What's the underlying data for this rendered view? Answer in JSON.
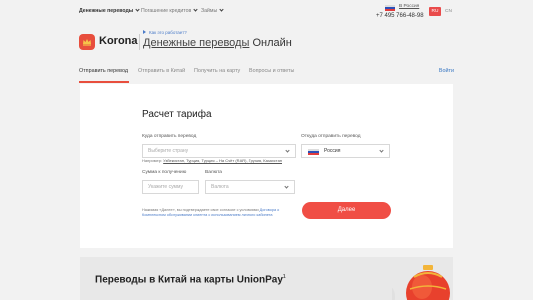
{
  "top_nav": {
    "items": [
      {
        "label": "Денежные переводы"
      },
      {
        "label": "Погашение кредитов"
      },
      {
        "label": "Займы"
      }
    ],
    "country": "В Россия",
    "phone": "+7 495 766-48-98",
    "langs": {
      "active": "RU",
      "other": "CN"
    }
  },
  "brand": {
    "logo_text": "Korona",
    "how_link": "Как это работает?",
    "title_underlined": "Денежные переводы",
    "title_rest": " Онлайн"
  },
  "tabs": {
    "items": [
      {
        "label": "Отправить перевод"
      },
      {
        "label": "Отправить в Китай"
      },
      {
        "label": "Получить на карту"
      },
      {
        "label": "Вопросы и ответы"
      }
    ],
    "login": "Войти"
  },
  "form": {
    "title": "Расчет тарифа",
    "dest_label": "Куда отправить перевод",
    "dest_placeholder": "Выберите страну",
    "hint_prefix": "Например: ",
    "hint_links": "Узбекистан, Турция, Турция – На Счёт (RAR), Грузия, Казахстан",
    "source_label": "Откуда отправить перевод",
    "source_value": "Россия",
    "amount_label": "Сумма к получению",
    "amount_placeholder": "Укажите сумму",
    "currency_label": "Валюта",
    "currency_placeholder": "Валюта",
    "consent_text": "Нажимая «Далее», вы подтверждаете свое согласие с условиями ",
    "consent_link": "Договора о Комплексном обслуживании клиента с использованием личного кабинета",
    "next_button": "Далее"
  },
  "banner": {
    "title": "Переводы в Китай на карты UnionPay",
    "sup": "1"
  },
  "colors": {
    "accent": "#f04e45",
    "link": "#4a7bc8",
    "background": "#f2f2f2"
  },
  "icons": [
    "chevron-down-icon",
    "russia-flag-icon",
    "crown-logo-icon",
    "play-triangle-icon"
  ]
}
